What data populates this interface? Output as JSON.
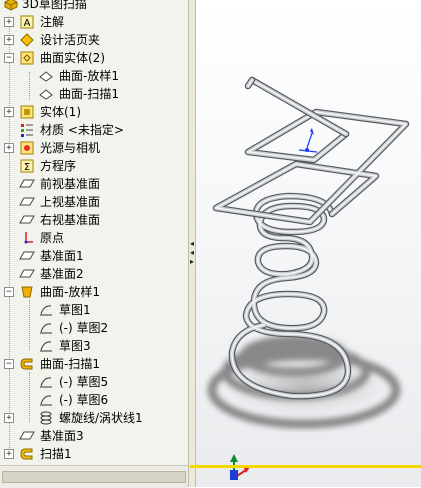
{
  "feature_tree": {
    "root": "3D草图扫描",
    "items": [
      {
        "label": "注解",
        "icon": "annotation-icon",
        "expander": "+"
      },
      {
        "label": "设计活页夹",
        "icon": "design-binder-icon",
        "expander": "+"
      },
      {
        "label": "曲面实体(2)",
        "icon": "surface-bodies-icon",
        "expander": "−"
      },
      {
        "label": "曲面-放样1",
        "icon": "surface-body-icon",
        "expander": ""
      },
      {
        "label": "曲面-扫描1",
        "icon": "surface-body-icon",
        "expander": ""
      },
      {
        "label": "实体(1)",
        "icon": "solid-bodies-icon",
        "expander": "+"
      },
      {
        "label": "材质 <未指定>",
        "icon": "material-icon",
        "expander": ""
      },
      {
        "label": "光源与相机",
        "icon": "lights-cameras-icon",
        "expander": "+"
      },
      {
        "label": "方程序",
        "icon": "equations-icon",
        "expander": ""
      },
      {
        "label": "前视基准面",
        "icon": "plane-icon",
        "expander": ""
      },
      {
        "label": "上视基准面",
        "icon": "plane-icon",
        "expander": ""
      },
      {
        "label": "右视基准面",
        "icon": "plane-icon",
        "expander": ""
      },
      {
        "label": "原点",
        "icon": "origin-icon",
        "expander": ""
      },
      {
        "label": "基准面1",
        "icon": "plane-icon",
        "expander": ""
      },
      {
        "label": "基准面2",
        "icon": "plane-icon",
        "expander": ""
      },
      {
        "label": "曲面-放样1",
        "icon": "surface-loft-icon",
        "expander": "−"
      },
      {
        "label": "草图1",
        "icon": "sketch-icon",
        "expander": ""
      },
      {
        "label": "(-) 草图2",
        "icon": "sketch-icon",
        "expander": ""
      },
      {
        "label": "草图3",
        "icon": "sketch-icon",
        "expander": ""
      },
      {
        "label": "曲面-扫描1",
        "icon": "surface-sweep-icon",
        "expander": "−"
      },
      {
        "label": "(-) 草图5",
        "icon": "sketch-icon",
        "expander": ""
      },
      {
        "label": "(-) 草图6",
        "icon": "sketch-icon",
        "expander": ""
      },
      {
        "label": "螺旋线/涡状线1",
        "icon": "helix-icon",
        "expander": "+"
      },
      {
        "label": "基准面3",
        "icon": "plane-icon",
        "expander": ""
      },
      {
        "label": "扫描1",
        "icon": "sweep-icon",
        "expander": "+"
      }
    ]
  },
  "colors": {
    "accent": "#f2d700",
    "tree_bg": "#f3f3ee",
    "viewport_top": "#ffffff",
    "viewport_bottom": "#e9ebee"
  }
}
